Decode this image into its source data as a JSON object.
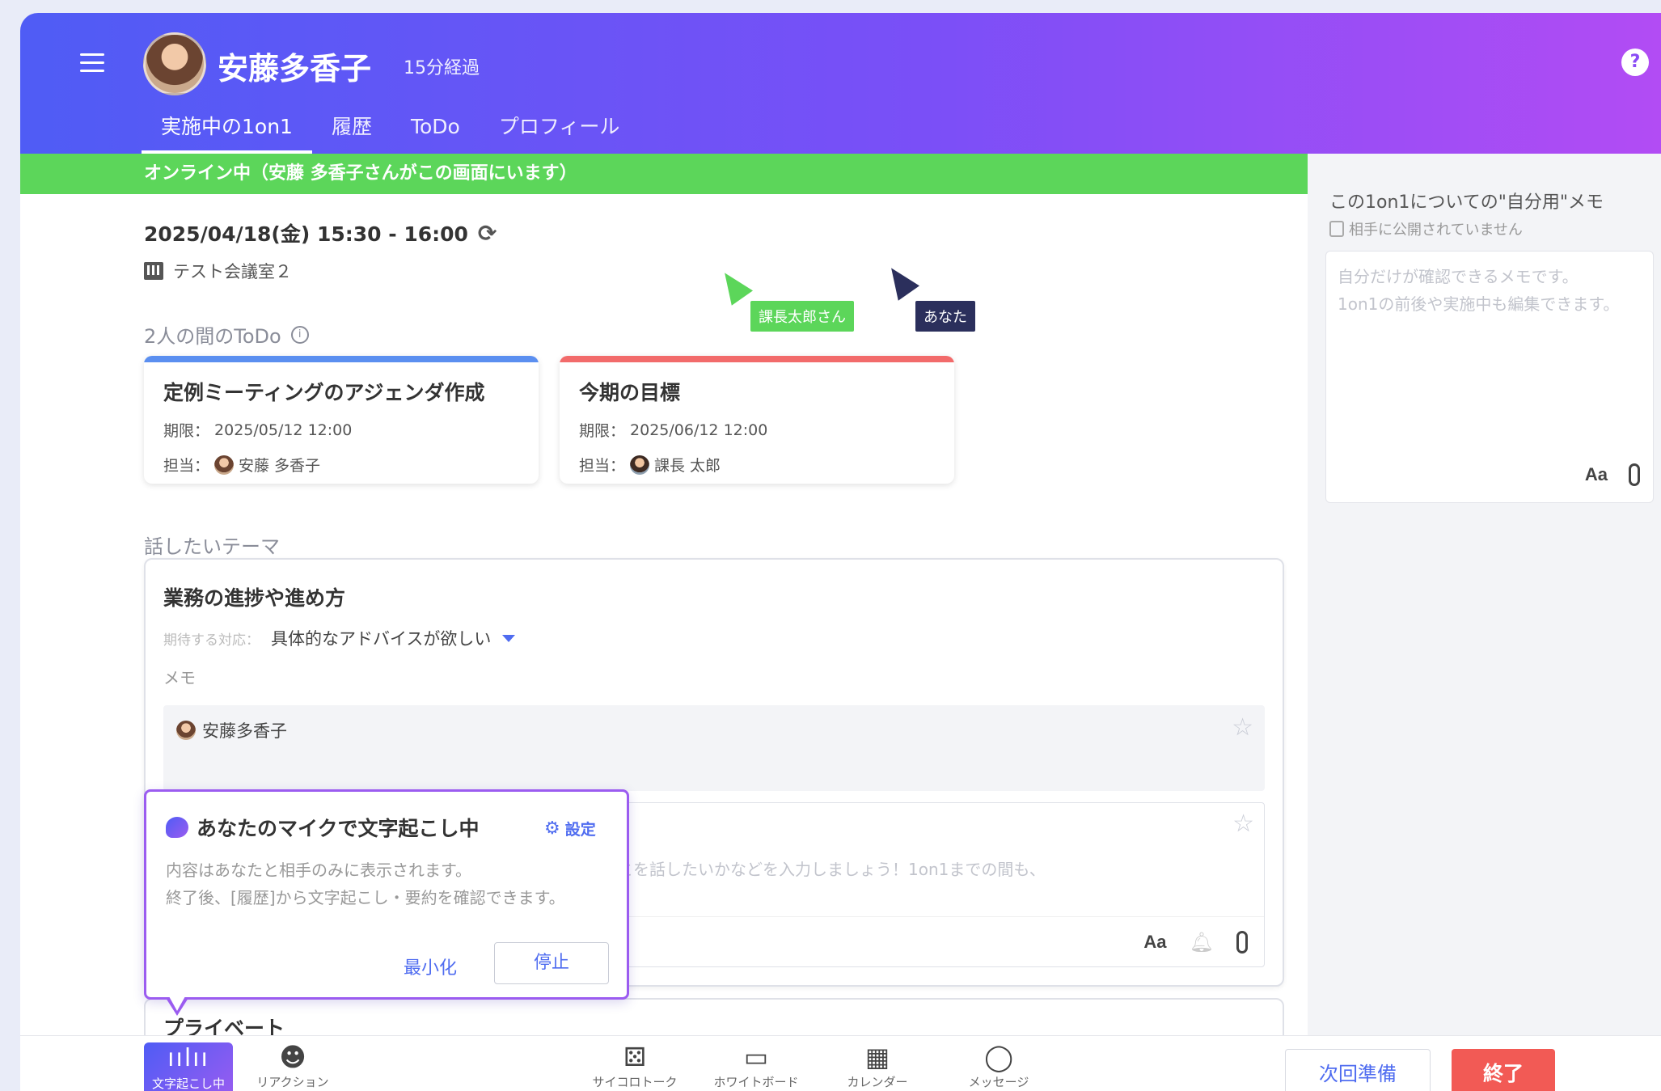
{
  "header": {
    "user_name": "安藤多香子",
    "elapsed": "15分経過",
    "help": "?",
    "tabs": [
      {
        "label": "実施中の1on1"
      },
      {
        "label": "履歴"
      },
      {
        "label": "ToDo"
      },
      {
        "label": "プロフィール"
      }
    ]
  },
  "online_status": "オンライン中（安藤 多香子さんがこの画面にいます）",
  "meeting": {
    "datetime": "2025/04/18(金) 15:30 - 16:00",
    "room": "テスト会議室２"
  },
  "cursors": {
    "other": "課長太郎さん",
    "self": "あなた"
  },
  "todo_section": {
    "label": "2人の間のToDo",
    "items": [
      {
        "title": "定例ミーティングのアジェンダ作成",
        "due_label": "期限：",
        "due": "2025/05/12 12:00",
        "owner_label": "担当：",
        "owner": "安藤 多香子",
        "color": "#5b8ff0"
      },
      {
        "title": "今期の目標",
        "due_label": "期限：",
        "due": "2025/06/12 12:00",
        "owner_label": "担当：",
        "owner": "課長 太郎",
        "color": "#f26b6b"
      }
    ]
  },
  "themes": {
    "label": "話したいテーマ",
    "item": {
      "title": "業務の進捗や進め方",
      "expect_label": "期待する対応：",
      "expect_value": "具体的なアドバイスが欲しい",
      "memo_label": "メモ",
      "comment_author": "安藤多香子",
      "input_placeholder": "どのようなことを話したいかなどを入力しましょう！1on1までの間も、"
    },
    "next_title": "プライベート"
  },
  "transcription": {
    "title": "あなたのマイクで文字起こし中",
    "setting": "設定",
    "line1": "内容はあなたと相手のみに表示されます。",
    "line2": "終了後、[履歴]から文字起こし・要約を確認できます。",
    "minimize": "最小化",
    "stop": "停止"
  },
  "private_memo": {
    "title": "この1on1についての\"自分用\"メモ",
    "subtitle": "相手に公開されていません",
    "placeholder": "自分だけが確認できるメモです。\n1on1の前後や実施中も編集できます。",
    "aa": "Aa"
  },
  "bottom": {
    "transcribing": "文字起こし中",
    "reaction": "リアクション",
    "dice_talk": "サイコロトーク",
    "whiteboard": "ホワイトボード",
    "calendar": "カレンダー",
    "message": "メッセージ",
    "next_prep": "次回準備",
    "end": "終了"
  },
  "toolbar": {
    "aa": "Aa"
  },
  "colors": {
    "accent": "#4f6cf0",
    "online": "#5cd65a",
    "end": "#f25a55",
    "transcribe_border": "#9b5cf0"
  }
}
